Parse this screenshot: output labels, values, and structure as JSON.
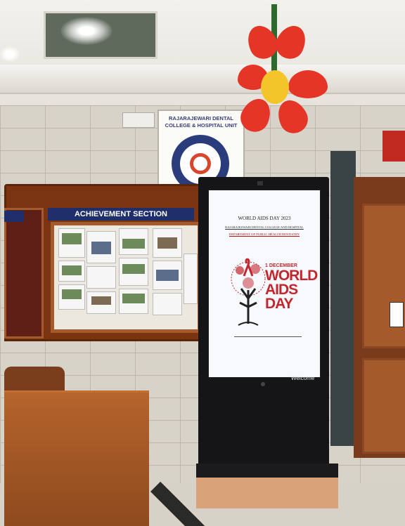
{
  "college_sign": {
    "line1": "RAJARAJEWARI DENTAL",
    "line2": "COLLEGE & HOSPITAL UNIT"
  },
  "notice_board": {
    "title": "ACHIEVEMENT SECTION"
  },
  "kiosk_screen": {
    "title": "WORLD AIDS DAY 2023",
    "subtitle1": "RAJARAJESWARI DENTAL COLLEGE AND HOSPITAL",
    "subtitle2": "DEPARTMENT OF PUBLIC HEALTH DENTISTRY",
    "date_text": "1 DECEMBER",
    "big_line1": "WORLD",
    "big_line2": "AIDS",
    "big_line3": "DAY",
    "welcome": "Welcome"
  },
  "colors": {
    "aids_red": "#c1272d",
    "board_wood": "#7a3412",
    "board_header_blue": "#1f2f6b",
    "flower_red": "#e43527",
    "flower_center": "#f3c52a"
  }
}
